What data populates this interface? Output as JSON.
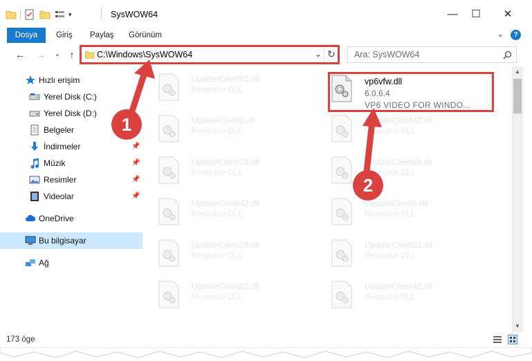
{
  "window": {
    "title": "SysWOW64",
    "minimize": "—",
    "maximize": "☐",
    "close": "✕"
  },
  "ribbon": {
    "tabs": [
      "Dosya",
      "Giriş",
      "Paylaş",
      "Görünüm"
    ],
    "expand": "⌄",
    "help": "?"
  },
  "nav": {
    "back": "←",
    "forward": "→",
    "recent": "⌄",
    "up": "↑"
  },
  "address": {
    "path": "C:\\Windows\\SysWOW64",
    "dropdown": "⌄",
    "refresh": "↻"
  },
  "search": {
    "placeholder": "Ara: SysWOW64",
    "icon": "search-icon"
  },
  "sidebar": {
    "items": [
      {
        "label": "Hızlı erişim",
        "icon": "star-icon"
      },
      {
        "label": "Yerel Disk (C:)",
        "icon": "drive-icon"
      },
      {
        "label": "Yerel Disk (D:)",
        "icon": "drive-icon"
      },
      {
        "label": "Belgeler",
        "icon": "documents-icon"
      },
      {
        "label": "İndirmeler",
        "icon": "downloads-icon"
      },
      {
        "label": "Müzik",
        "icon": "music-icon"
      },
      {
        "label": "Resimler",
        "icon": "pictures-icon"
      },
      {
        "label": "Videolar",
        "icon": "videos-icon"
      },
      {
        "label": "OneDrive",
        "icon": "cloud-icon"
      },
      {
        "label": "Bu bilgisayar",
        "icon": "computer-icon"
      },
      {
        "label": "Ağ",
        "icon": "network-icon"
      }
    ]
  },
  "files": {
    "left": [
      {
        "name": "UpdateClient65.dll",
        "desc": "Resource DLL"
      },
      {
        "name": "UpdateClient5.dll",
        "desc": "Resource DLL"
      },
      {
        "name": "UpdateClient19.dll",
        "desc": "Resource DLL"
      },
      {
        "name": "UpdateClient42.dll",
        "desc": "Resource DLL"
      },
      {
        "name": "UpdateClient19.dll",
        "desc": "Resource DLL"
      },
      {
        "name": "UpdateClient63.dll",
        "desc": "Resource DLL"
      }
    ],
    "right": [
      {
        "name": "UpdateClient42.dll",
        "desc": "Resource DLL"
      },
      {
        "name": "UpdateClient65.dll",
        "desc": "Resource DLL"
      },
      {
        "name": "UpdateClient5.dll",
        "desc": "Resource DLL"
      },
      {
        "name": "UpdateClient21.dll",
        "desc": "Resource DLL"
      },
      {
        "name": "UpdateClient42.dll",
        "desc": "Resource DLL"
      }
    ],
    "highlighted": {
      "name": "vp6vfw.dll",
      "version": "6.0.6.4",
      "description": "VP6 VIDEO FOR WINDO..."
    }
  },
  "annotations": {
    "step1": "1",
    "step2": "2",
    "color": "#d9423f"
  },
  "status": {
    "count": "173 öge"
  },
  "colors": {
    "accent": "#1979ca",
    "selection": "#cce8ff",
    "highlight_red": "#d9423f"
  }
}
